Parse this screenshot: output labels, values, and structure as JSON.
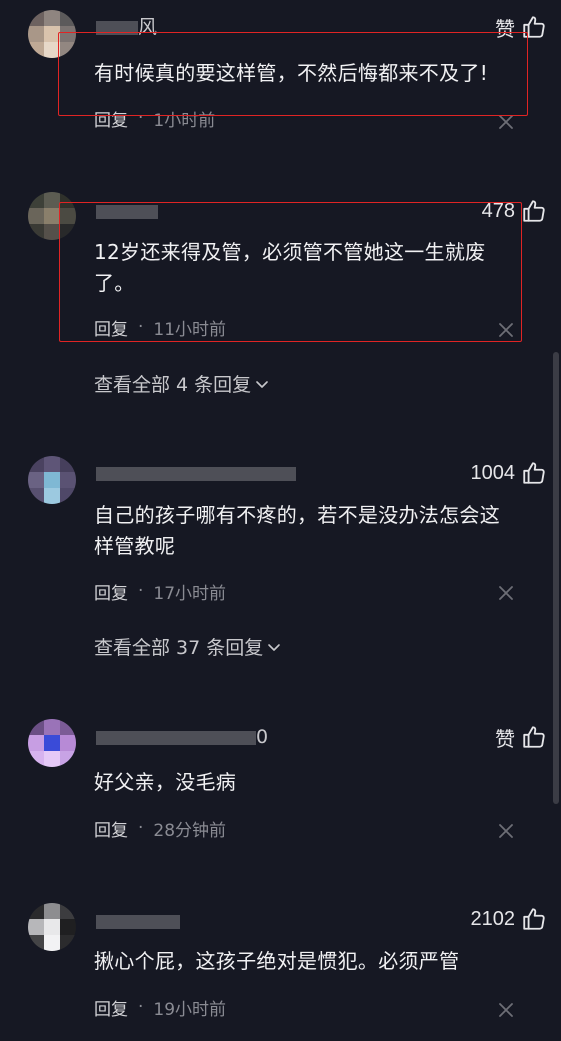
{
  "comments": [
    {
      "username_visible": "风",
      "likes": "赞",
      "text": "有时候真的要这样管，不然后悔都来不及了!",
      "reply_label": "回复",
      "time": "1小时前"
    },
    {
      "username_visible": "",
      "likes": "478",
      "text": "12岁还来得及管，必须管不管她这一生就废了。",
      "reply_label": "回复",
      "time": "11小时前"
    },
    {
      "username_visible": "",
      "likes": "1004",
      "text": "自己的孩子哪有不疼的，若不是没办法怎会这样管教呢",
      "reply_label": "回复",
      "time": "17小时前"
    },
    {
      "username_visible": "0",
      "likes": "赞",
      "text": "好父亲，没毛病",
      "reply_label": "回复",
      "time": "28分钟前"
    },
    {
      "username_visible": "",
      "likes": "2102",
      "text": "揪心个屁，这孩子绝对是惯犯。必须严管",
      "reply_label": "回复",
      "time": "19小时前"
    }
  ],
  "expanders": [
    {
      "label": "查看全部 4 条回复"
    },
    {
      "label": "查看全部 37 条回复"
    }
  ],
  "separator": "·",
  "icons": {
    "like": "thumbs-up-outline",
    "close": "x-mark",
    "expand": "chevron-down"
  },
  "colors": {
    "background": "#161823",
    "highlight_box": "#e02424",
    "secondary_text": "#8a8b93"
  }
}
